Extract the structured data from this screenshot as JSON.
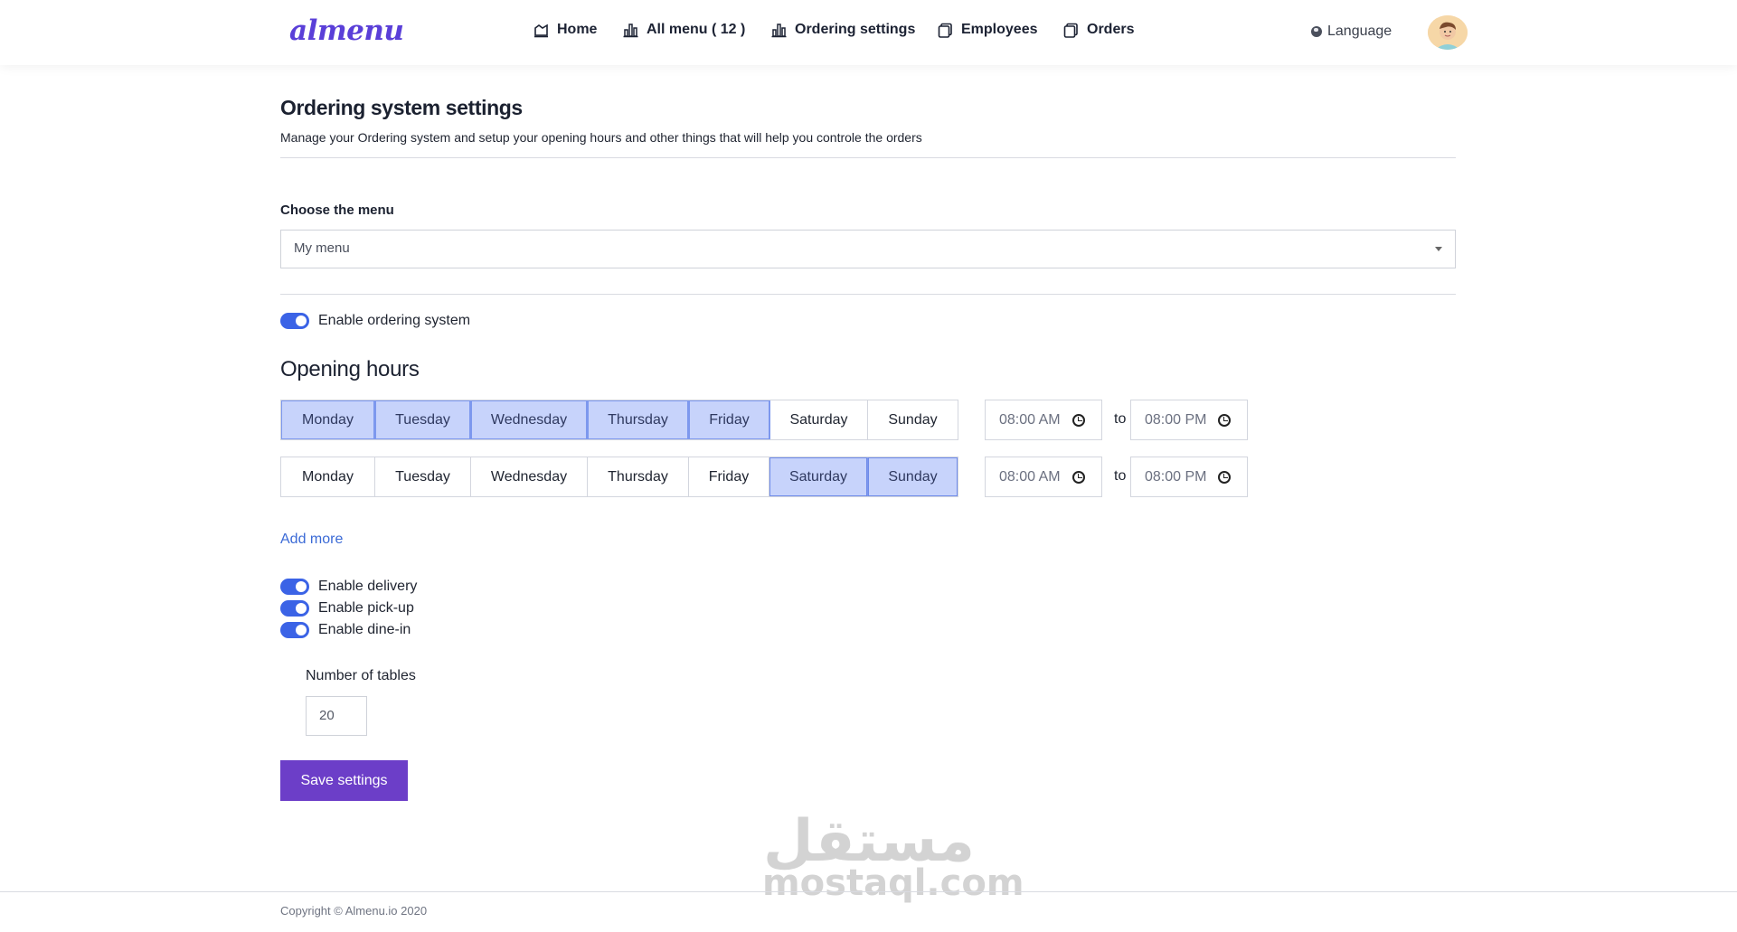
{
  "brand": {
    "logo_text": "almenu",
    "accent": "#5a3fd8"
  },
  "nav": {
    "items": [
      {
        "label": "Home",
        "icon": "home-chart-icon"
      },
      {
        "label": "All menu ( 12 )",
        "icon": "bar-chart-icon"
      },
      {
        "label": "Ordering settings",
        "icon": "bar-chart-icon"
      },
      {
        "label": "Employees",
        "icon": "copy-icon"
      },
      {
        "label": "Orders",
        "icon": "copy-icon"
      }
    ],
    "language_label": "Language"
  },
  "page": {
    "title": "Ordering system settings",
    "subtitle": "Manage your Ordering system and setup your opening hours and other things that will help you controle the orders"
  },
  "menu_select": {
    "label": "Choose the menu",
    "value": "My menu"
  },
  "ordering_toggle": {
    "label": "Enable ordering system",
    "enabled": true
  },
  "opening_hours": {
    "title": "Opening hours",
    "rows": [
      {
        "days": [
          {
            "label": "Monday",
            "selected": true
          },
          {
            "label": "Tuesday",
            "selected": true
          },
          {
            "label": "Wednesday",
            "selected": true
          },
          {
            "label": "Thursday",
            "selected": true
          },
          {
            "label": "Friday",
            "selected": true
          },
          {
            "label": "Saturday",
            "selected": false
          },
          {
            "label": "Sunday",
            "selected": false
          }
        ],
        "from": "08:00 AM",
        "to_label": "to",
        "until": "08:00 PM"
      },
      {
        "days": [
          {
            "label": "Monday",
            "selected": false
          },
          {
            "label": "Tuesday",
            "selected": false
          },
          {
            "label": "Wednesday",
            "selected": false
          },
          {
            "label": "Thursday",
            "selected": false
          },
          {
            "label": "Friday",
            "selected": false
          },
          {
            "label": "Saturday",
            "selected": true
          },
          {
            "label": "Sunday",
            "selected": true
          }
        ],
        "from": "08:00 AM",
        "to_label": "to",
        "until": "08:00 PM"
      }
    ],
    "add_more_label": "Add more"
  },
  "services": [
    {
      "label": "Enable delivery",
      "enabled": true
    },
    {
      "label": "Enable pick-up",
      "enabled": true
    },
    {
      "label": "Enable dine-in",
      "enabled": true
    }
  ],
  "tables": {
    "label": "Number of tables",
    "value": "20"
  },
  "save_label": "Save settings",
  "watermark": {
    "arabic": "مستقل",
    "latin": "mostaql.com"
  },
  "footer": {
    "copyright": "Copyright © Almenu.io 2020"
  },
  "colors": {
    "primary_button": "#6c3ec8",
    "toggle_on": "#3b63e6",
    "day_selected": "#c7d3fb",
    "link": "#3b6ad6"
  }
}
